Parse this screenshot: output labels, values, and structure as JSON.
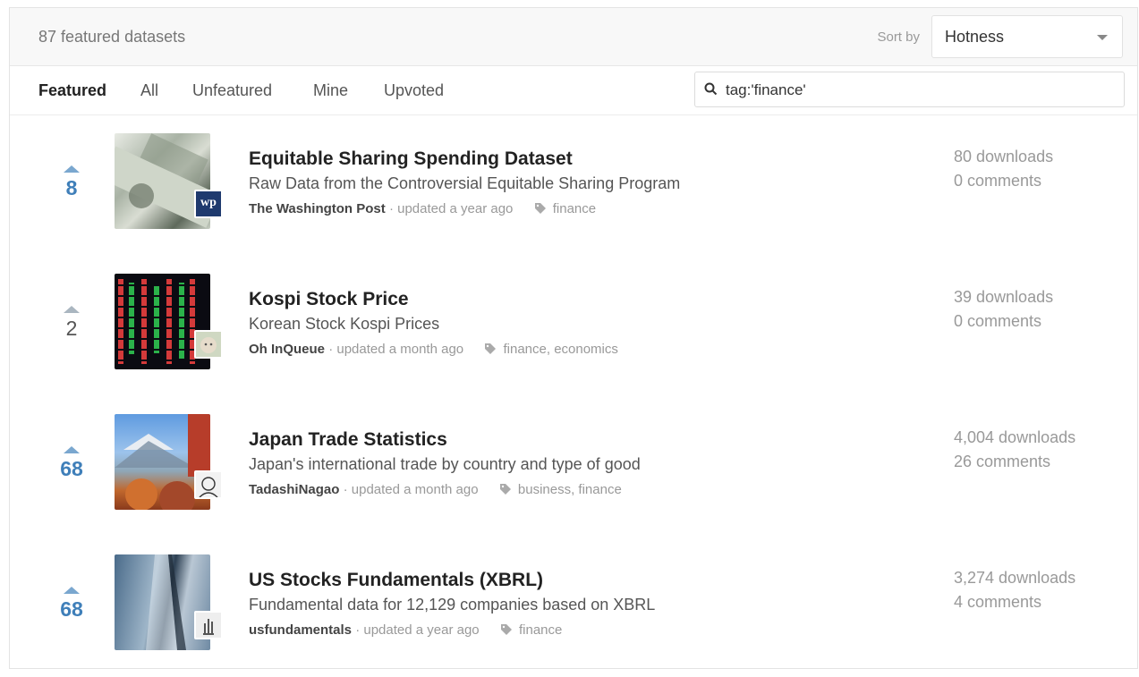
{
  "header": {
    "count_label": "87 featured datasets",
    "sort_label": "Sort by",
    "sort_value": "Hotness"
  },
  "tabs": [
    {
      "label": "Featured",
      "active": true
    },
    {
      "label": "All",
      "active": false
    },
    {
      "label": "Unfeatured",
      "active": false
    },
    {
      "label": "Mine",
      "active": false
    },
    {
      "label": "Upvoted",
      "active": false
    }
  ],
  "search": {
    "value": "tag:'finance'",
    "icon": "search-icon"
  },
  "datasets": [
    {
      "votes": "8",
      "title": "Equitable Sharing Spending Dataset",
      "subtitle": "Raw Data from the Controversial Equitable Sharing Program",
      "owner": "The Washington Post",
      "updated": "· updated a year ago",
      "tags": "finance",
      "downloads": "80 downloads",
      "comments": "0 comments",
      "avatar_text": "wp"
    },
    {
      "votes": "2",
      "title": "Kospi Stock Price",
      "subtitle": "Korean Stock Kospi Prices",
      "owner": "Oh InQueue",
      "updated": "· updated a month ago",
      "tags": "finance, economics",
      "downloads": "39 downloads",
      "comments": "0 comments"
    },
    {
      "votes": "68",
      "title": "Japan Trade Statistics",
      "subtitle": "Japan's international trade by country and type of good",
      "owner": "TadashiNagao",
      "updated": "· updated a month ago",
      "tags": "business, finance",
      "downloads": "4,004 downloads",
      "comments": "26 comments"
    },
    {
      "votes": "68",
      "title": "US Stocks Fundamentals (XBRL)",
      "subtitle": "Fundamental data for 12,129 companies based on XBRL",
      "owner": "usfundamentals",
      "updated": "· updated a year ago",
      "tags": "finance",
      "downloads": "3,274 downloads",
      "comments": "4 comments"
    }
  ],
  "colors": {
    "vote_accent": "#3f7fb9",
    "vote_arrow": "#7aa7cf",
    "muted_text": "#999999"
  }
}
